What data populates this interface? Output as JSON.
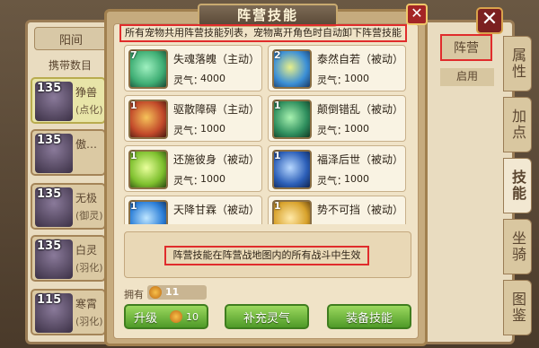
{
  "background_panel": {
    "tab_label": "阳间",
    "subheading": "携带数目",
    "pets": [
      {
        "level": "135",
        "name": "狰兽",
        "sub": "(点化)",
        "active": true
      },
      {
        "level": "135",
        "name": "傲…",
        "sub": ""
      },
      {
        "level": "135",
        "name": "无极",
        "sub": "(御灵)"
      },
      {
        "level": "135",
        "name": "白灵",
        "sub": "(羽化)"
      },
      {
        "level": "115",
        "name": "寒霄",
        "sub": "(羽化)"
      }
    ],
    "faction_button": "阵营",
    "enable_column": "启用",
    "side_tabs": [
      "属性",
      "加点",
      "技能",
      "坐骑",
      "图鉴"
    ],
    "active_side_tab": "技能",
    "close_symbol": "✕"
  },
  "dialog": {
    "title": "阵营技能",
    "close_symbol": "✕",
    "description": "所有宠物共用阵营技能列表，宠物离开角色时自动卸下阵营技能",
    "aura_label": "灵气：",
    "skills": [
      {
        "count": "7",
        "name": "失魂落魄（主动）",
        "aura": "4000",
        "color": "#3fae74"
      },
      {
        "count": "2",
        "name": "泰然自若（被动）",
        "aura": "1000",
        "color": "#3b8fd6"
      },
      {
        "count": "1",
        "name": "驱散障碍（主动）",
        "aura": "1000",
        "color": "#c24a2a"
      },
      {
        "count": "1",
        "name": "颠倒错乱（被动）",
        "aura": "1000",
        "color": "#2f8f5e"
      },
      {
        "count": "1",
        "name": "还施彼身（被动）",
        "aura": "1000",
        "color": "#7ec02e"
      },
      {
        "count": "1",
        "name": "福泽后世（被动）",
        "aura": "1000",
        "color": "#2c5fb8"
      },
      {
        "count": "1",
        "name": "天降甘霖（被动）",
        "aura": "1000",
        "color": "#2c7fd8"
      },
      {
        "count": "1",
        "name": "势不可挡（被动）",
        "aura": "1000",
        "color": "#d8a22c"
      }
    ],
    "effect_note": "阵营技能在阵营战地图内的所有战斗中生效",
    "owned_label": "拥有",
    "owned_value": "11",
    "buttons": {
      "upgrade": "升级",
      "upgrade_cost": "10",
      "replenish": "补充灵气",
      "equip": "装备技能"
    }
  }
}
